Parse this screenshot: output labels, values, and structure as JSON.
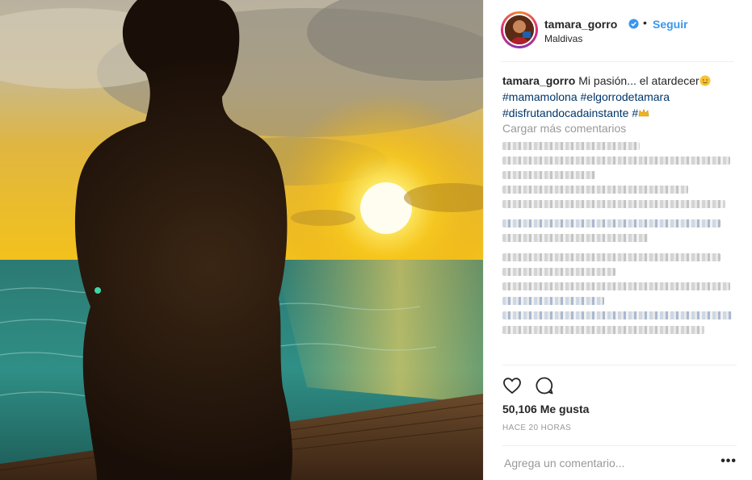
{
  "post": {
    "username": "tamara_gorro",
    "verified_icon": "verified-badge-icon",
    "separator": "•",
    "follow_label": "Seguir",
    "location": "Maldivas"
  },
  "caption": {
    "username": "tamara_gorro",
    "text": "Mi pasión... el atardecer",
    "hashtags": [
      "#mamamolona",
      "#elgorrodetamara",
      "#disfrutandocadainstante",
      "#"
    ]
  },
  "comments": {
    "load_more": "Cargar más comentarios"
  },
  "actions": {
    "like_icon": "heart-icon",
    "comment_icon": "comment-icon"
  },
  "likes_text": "50,106 Me gusta",
  "timestamp": "HACE 20 HORAS",
  "add_comment": {
    "placeholder": "Agrega un comentario...",
    "more_label": "•••"
  },
  "colors": {
    "link": "#3897f0",
    "hashtag": "#003569",
    "text": "#262626",
    "muted": "#999999"
  }
}
